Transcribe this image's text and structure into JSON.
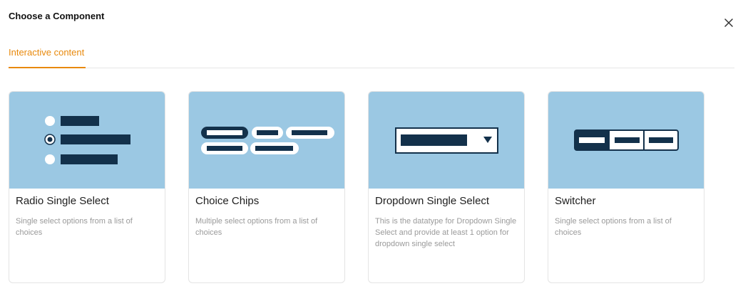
{
  "dialog": {
    "title": "Choose a Component",
    "close_icon": "close-icon"
  },
  "tabs": [
    {
      "label": "Interactive content",
      "active": true
    }
  ],
  "colors": {
    "accent": "#e8890c",
    "thumb_bg": "#9bc8e3",
    "thumb_dark": "#13314b"
  },
  "cards": [
    {
      "title": "Radio Single Select",
      "description": "Single select options from a list of choices",
      "icon": "radio-list-icon"
    },
    {
      "title": "Choice Chips",
      "description": "Multiple select options from a list of choices",
      "icon": "chips-icon"
    },
    {
      "title": "Dropdown Single Select",
      "description": "This is the datatype for Dropdown Single Select and provide at least 1 option for dropdown single select",
      "icon": "dropdown-icon"
    },
    {
      "title": "Switcher",
      "description": "Single select options from a list of choices",
      "icon": "segmented-switch-icon"
    }
  ]
}
